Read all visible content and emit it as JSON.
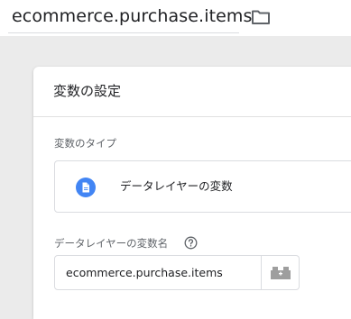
{
  "header": {
    "variable_name": "ecommerce.purchase.items",
    "folder_icon": "folder-icon"
  },
  "card": {
    "title": "変数の設定",
    "type_section_label": "変数のタイプ",
    "type": {
      "icon": "document-icon",
      "icon_color": "#4285f4",
      "name": "データレイヤーの変数"
    },
    "datalayer_name_label": "データレイヤーの変数名",
    "help_icon": "help-circle-icon",
    "datalayer_name_value": "ecommerce.purchase.items",
    "variable_picker_icon": "variable-picker-icon"
  }
}
